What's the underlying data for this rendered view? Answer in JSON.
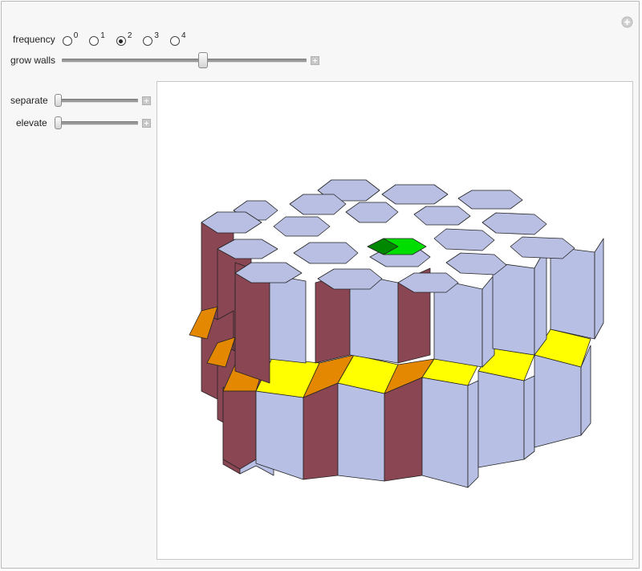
{
  "controls": {
    "frequency": {
      "label": "frequency",
      "options": [
        "0",
        "1",
        "2",
        "3",
        "4"
      ],
      "selected": "2"
    },
    "grow_walls": {
      "label": "grow walls",
      "value_fraction": 0.58
    },
    "separate": {
      "label": "separate",
      "value_fraction": 0.0
    },
    "elevate": {
      "label": "elevate",
      "value_fraction": 0.0
    }
  },
  "icons": {
    "corner": "plus-circle-icon",
    "slider_expand": "plus-square-icon"
  },
  "colors": {
    "top_face": "#b9bfe3",
    "wall_dark": "#8b4654",
    "wall_light": "#b7c0e4",
    "yellow": "#ffff00",
    "orange": "#e38800",
    "green": "#00cc00",
    "edge": "#222222"
  }
}
